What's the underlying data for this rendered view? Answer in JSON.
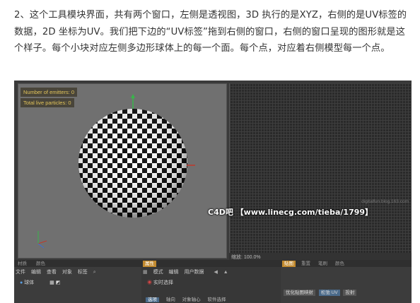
{
  "article": {
    "paragraph": "2、这个工具模块界面，共有两个窗口，左侧是透视图，3D 执行的是XYZ，右侧的是UV标签的数据，2D 坐标为UV。我们把下边的“UV标签”拖到右侧的窗口，右侧的窗口呈现的图形就是这个样子。每个小块对应左侧多边形球体上的每一个面。每个点，对应着右侧模型每一个点。"
  },
  "viewport": {
    "hud_emitters": "Number of emitters: 0",
    "hud_particles": "Total live particles: 0"
  },
  "uv_editor": {
    "zoom_status": "缩放: 100.0%",
    "watermark": "digitalfun.blog.163.com"
  },
  "left_panel": {
    "tabs": [
      "材质",
      "颜色"
    ],
    "menu": [
      "文件",
      "编辑",
      "查看",
      "对象",
      "标签"
    ],
    "object_label": "球体"
  },
  "mid_panel": {
    "tab": "属性",
    "menu": [
      "模式",
      "编辑",
      "用户数据"
    ],
    "option": "实时选择",
    "sub_tabs": [
      "选项",
      "轴向",
      "对象轴心",
      "软件选择"
    ]
  },
  "right_panel": {
    "tabs": [
      "贴图",
      "重置",
      "笔刷",
      "颜色"
    ],
    "buttons": [
      "优化贴图映射",
      "松弛 UV",
      "投射"
    ]
  },
  "page_watermark": "C4D吧 【www.linecg.com/tieba/1799】"
}
